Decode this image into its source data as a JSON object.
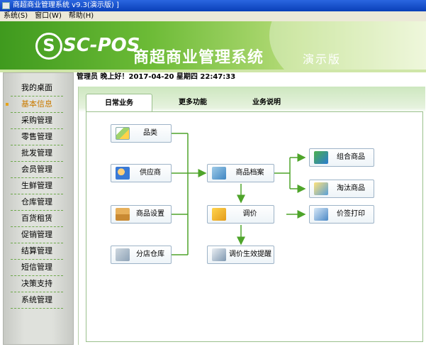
{
  "window": {
    "title": "商超商业管理系统 v9.3(演示版) ]"
  },
  "menu": [
    "系统(S)",
    "窗口(W)",
    "帮助(H)"
  ],
  "header": {
    "logo_mark": "S",
    "logo_text": "SC-POS",
    "system_title": "商超商业管理系统",
    "demo_label": "演示版",
    "brand_color": "#4ea42a"
  },
  "status": {
    "text": "管理员 晚上好！2017-04-20 星期四 22:47:33"
  },
  "sidebar": {
    "items": [
      {
        "label": "我的桌面"
      },
      {
        "label": "基本信息"
      },
      {
        "label": "采购管理"
      },
      {
        "label": "零售管理"
      },
      {
        "label": "批发管理"
      },
      {
        "label": "会员管理"
      },
      {
        "label": "生鲜管理"
      },
      {
        "label": "仓库管理"
      },
      {
        "label": "百货租赁"
      },
      {
        "label": "促销管理"
      },
      {
        "label": "结算管理"
      },
      {
        "label": "短信管理"
      },
      {
        "label": "决策支持"
      },
      {
        "label": "系统管理"
      }
    ],
    "active_index": 1
  },
  "tabs": [
    {
      "label": "日常业务",
      "active": true
    },
    {
      "label": "更多功能",
      "active": false
    },
    {
      "label": "业务说明",
      "active": false
    }
  ],
  "flow": {
    "pinlei": "品类",
    "supplier": "供应商",
    "goods_setup": "商品设置",
    "branch_store": "分店仓库",
    "goods_archive": "商品档案",
    "price_adjust": "调价",
    "price_effect": "调价生效提醒",
    "combo_goods": "组合商品",
    "retired_goods": "淘汰商品",
    "price_tag": "价签打印",
    "line_color": "#4ea42a",
    "icons": [
      "category-icon",
      "supplier-icon",
      "goods-icon",
      "store-icon",
      "archive-icon",
      "price-icon",
      "reminder-icon",
      "combo-icon",
      "retire-icon",
      "print-icon"
    ]
  }
}
